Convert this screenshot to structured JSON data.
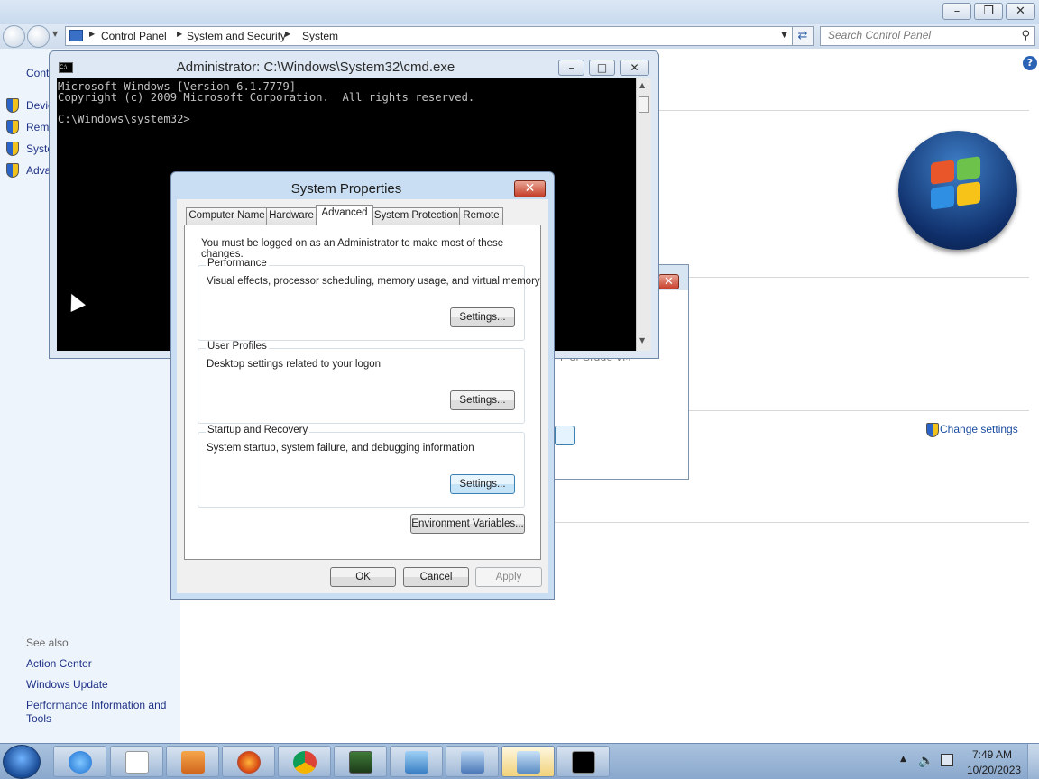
{
  "control_panel": {
    "breadcrumb": [
      "Control Panel",
      "System and Security",
      "System"
    ],
    "search_placeholder": "Search Control Panel",
    "left_nav": [
      "Control Panel Home",
      "Device Manager",
      "Remote settings",
      "System protection",
      "Advanced system settings"
    ],
    "left_nav_visible": [
      "Cont",
      "Devic",
      "Remo",
      "Syste",
      "Adva"
    ],
    "see_also_title": "See also",
    "see_also_links": [
      "Action Center",
      "Windows Update",
      "Performance Information and",
      "Tools"
    ],
    "change_settings": "Change settings",
    "background_dialog_text": "n of Grade VM"
  },
  "cmd": {
    "title": "Administrator: C:\\Windows\\System32\\cmd.exe",
    "lines": [
      "Microsoft Windows [Version 6.1.7779]",
      "Copyright (c) 2009 Microsoft Corporation.  All rights reserved.",
      "",
      "C:\\Windows\\system32>"
    ]
  },
  "system_properties": {
    "title": "System Properties",
    "tabs": [
      "Computer Name",
      "Hardware",
      "Advanced",
      "System Protection",
      "Remote"
    ],
    "active_tab": "Advanced",
    "note": "You must be logged on as an Administrator to make most of these changes.",
    "groups": [
      {
        "title": "Performance",
        "description": "Visual effects, processor scheduling, memory usage, and virtual memory",
        "button": "Settings..."
      },
      {
        "title": "User Profiles",
        "description": "Desktop settings related to your logon",
        "button": "Settings..."
      },
      {
        "title": "Startup and Recovery",
        "description": "System startup, system failure, and debugging information",
        "button": "Settings..."
      }
    ],
    "env_button": "Environment Variables...",
    "ok": "OK",
    "cancel": "Cancel",
    "apply": "Apply"
  },
  "taskbar": {
    "items": [
      "internet-explorer",
      "notepad",
      "media-player",
      "firefox",
      "chrome",
      "remote-desktop",
      "control-panel",
      "computer",
      "system-properties",
      "command-prompt"
    ],
    "time": "7:49 AM",
    "date": "10/20/2023"
  },
  "colors": {
    "link": "#1e3287",
    "taskbar": "#8aa8cd",
    "close_red": "#c43d27"
  }
}
